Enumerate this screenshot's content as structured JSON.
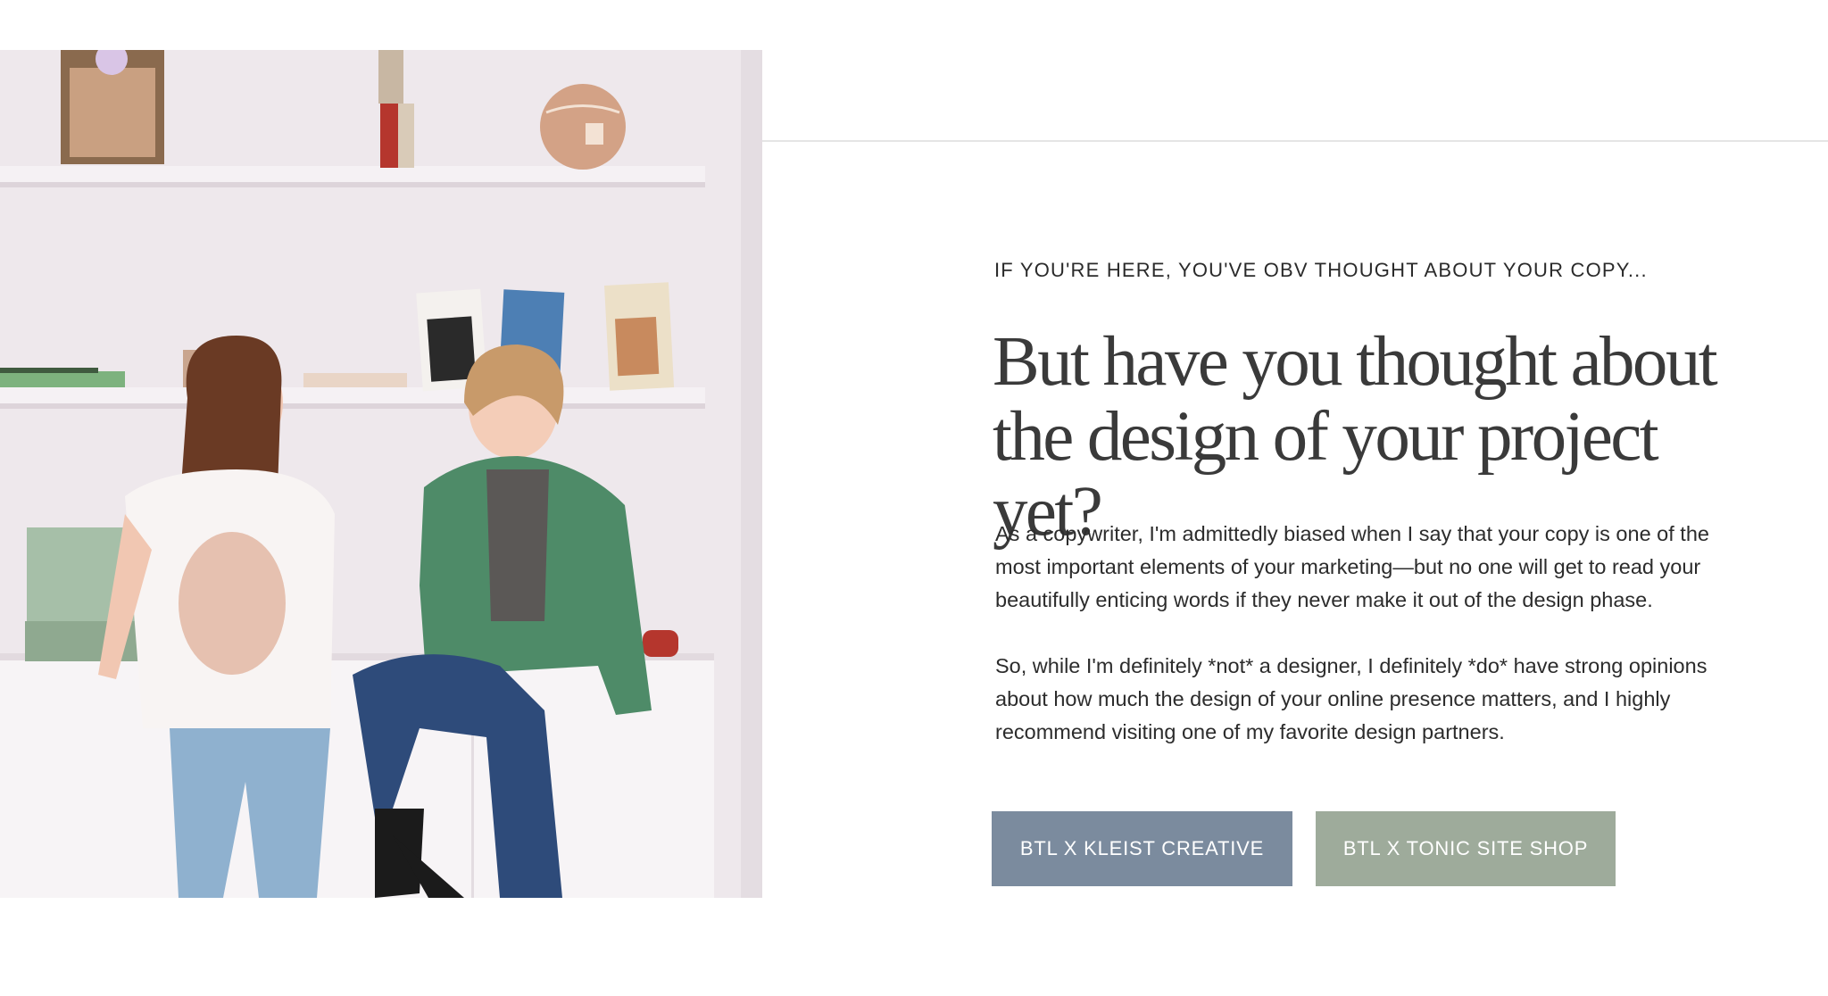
{
  "hero": {
    "eyebrow": "IF YOU'RE HERE, YOU'VE OBV THOUGHT ABOUT YOUR COPY...",
    "headline_line1": "But have you thought about",
    "headline_line2": "the design of your project yet?",
    "paragraph1": "As a copywriter, I'm admittedly biased when I say that your copy is one of the most important elements of your marketing—but no one will get to read your beautifully enticing words if they never make it out of the design phase.",
    "paragraph2": "So, while I'm definitely *not* a designer, I definitely *do* have strong opinions about how much the design of your online presence matters, and I highly recommend visiting one of my favorite design partners."
  },
  "buttons": {
    "kleist_label": "BTL X KLEIST CREATIVE",
    "tonic_label": "BTL X TONIC SITE SHOP"
  },
  "colors": {
    "kleist_button": "#7b8b9e",
    "tonic_button": "#9eab9b",
    "divider": "#e5e5e5",
    "headline_text": "#3a3a3a"
  }
}
